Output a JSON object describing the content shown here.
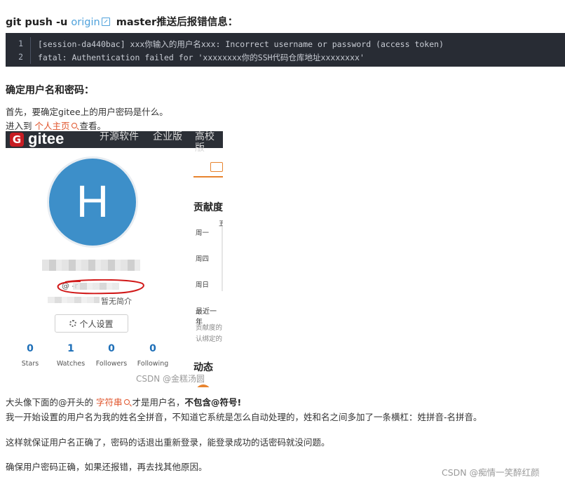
{
  "heading1": {
    "pre": "git push -u ",
    "link": "origin",
    "post": " master推送后报错信息："
  },
  "code": {
    "lines": [
      {
        "num": "1",
        "text": "[session-da440bac] xxx你输入的用户名xxx: Incorrect username or password (access token)"
      },
      {
        "num": "2",
        "text": "fatal: Authentication failed for 'xxxxxxxx你的SSH代码仓库地址xxxxxxxx'"
      }
    ]
  },
  "heading2": "确定用户名和密码：",
  "para1": "首先，要确定gitee上的用户密码是什么。",
  "para2": {
    "pre": "进入到 ",
    "link": "个人主页",
    "post": " 查看。"
  },
  "gitee_shot": {
    "logo_letter": "G",
    "brand": "gitee",
    "nav": [
      "开源软件",
      "企业版",
      "高校版"
    ],
    "avatar_letter": "H",
    "handle": "@        -r",
    "bio": "暂无简介",
    "settings_button": "个人设置",
    "stats": [
      {
        "value": "0",
        "label": "Stars"
      },
      {
        "value": "1",
        "label": "Watches"
      },
      {
        "value": "0",
        "label": "Followers"
      },
      {
        "value": "0",
        "label": "Following"
      }
    ],
    "right_title": "贡献度",
    "day_mon": "周一",
    "day_thu": "周四",
    "day_sun": "周日",
    "col_label": "五",
    "recent": "最近一年",
    "note1": "贡献度的",
    "note2": "认绑定的",
    "activity": "动态",
    "watermark": "CSDN @金糕汤圆"
  },
  "para3": {
    "pre": "大头像下面的@开头的 ",
    "link": "字符串",
    "mid": " 才是用户名，",
    "bold": "不包含@符号!"
  },
  "para4": "我一开始设置的用户名为我的姓名全拼音，不知道它系统是怎么自动处理的，姓和名之间多加了一条横杠：姓拼音-名拼音。",
  "para5": "这样就保证用户名正确了，密码的话退出重新登录，能登录成功的话密码就没问题。",
  "para6": "确保用户密码正确，如果还报错，再去找其他原因。",
  "watermark": "CSDN @痴情一笑醉红颜",
  "colors": {
    "link_blue": "#4ea1db",
    "link_orange": "#e0532a",
    "code_bg": "#282c34",
    "gitee_red": "#c71d23",
    "annotation_red": "#d11a1a"
  }
}
